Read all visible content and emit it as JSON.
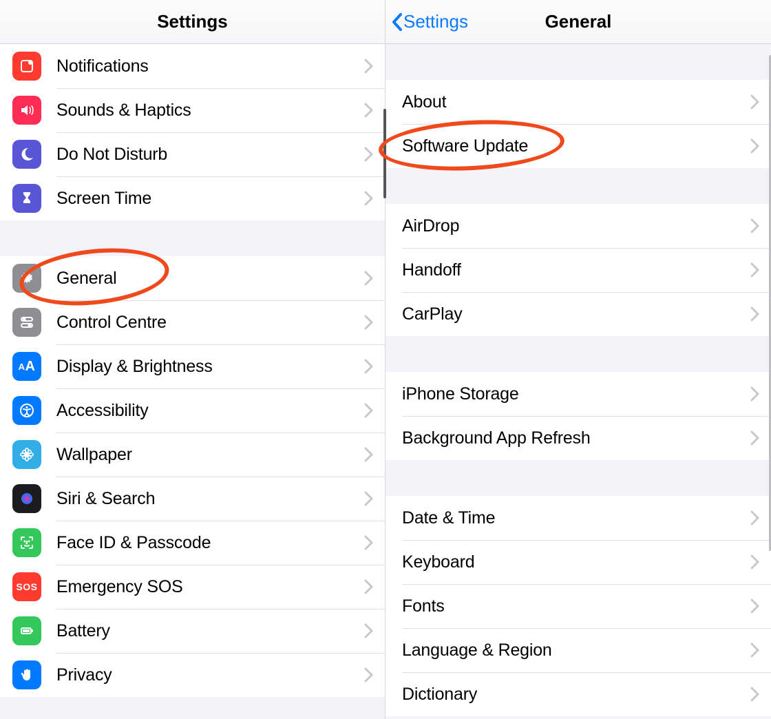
{
  "left": {
    "title": "Settings",
    "groups": [
      {
        "rows": [
          {
            "id": "notifications",
            "label": "Notifications"
          },
          {
            "id": "sounds",
            "label": "Sounds & Haptics"
          },
          {
            "id": "dnd",
            "label": "Do Not Disturb"
          },
          {
            "id": "screentime",
            "label": "Screen Time"
          }
        ]
      },
      {
        "rows": [
          {
            "id": "general",
            "label": "General"
          },
          {
            "id": "controlcentre",
            "label": "Control Centre"
          },
          {
            "id": "display",
            "label": "Display & Brightness"
          },
          {
            "id": "accessibility",
            "label": "Accessibility"
          },
          {
            "id": "wallpaper",
            "label": "Wallpaper"
          },
          {
            "id": "siri",
            "label": "Siri & Search"
          },
          {
            "id": "faceid",
            "label": "Face ID & Passcode"
          },
          {
            "id": "sos",
            "label": "Emergency SOS"
          },
          {
            "id": "battery",
            "label": "Battery"
          },
          {
            "id": "privacy",
            "label": "Privacy"
          }
        ]
      }
    ]
  },
  "right": {
    "back": "Settings",
    "title": "General",
    "groups": [
      {
        "rows": [
          {
            "id": "about",
            "label": "About"
          },
          {
            "id": "softwareupdate",
            "label": "Software Update"
          }
        ]
      },
      {
        "rows": [
          {
            "id": "airdrop",
            "label": "AirDrop"
          },
          {
            "id": "handoff",
            "label": "Handoff"
          },
          {
            "id": "carplay",
            "label": "CarPlay"
          }
        ]
      },
      {
        "rows": [
          {
            "id": "storage",
            "label": "iPhone Storage"
          },
          {
            "id": "bgrefresh",
            "label": "Background App Refresh"
          }
        ]
      },
      {
        "rows": [
          {
            "id": "datetime",
            "label": "Date & Time"
          },
          {
            "id": "keyboard",
            "label": "Keyboard"
          },
          {
            "id": "fonts",
            "label": "Fonts"
          },
          {
            "id": "langregion",
            "label": "Language & Region"
          },
          {
            "id": "dictionary",
            "label": "Dictionary"
          }
        ]
      }
    ]
  },
  "annotations": {
    "circled_left": "General",
    "circled_right": "Software Update"
  }
}
